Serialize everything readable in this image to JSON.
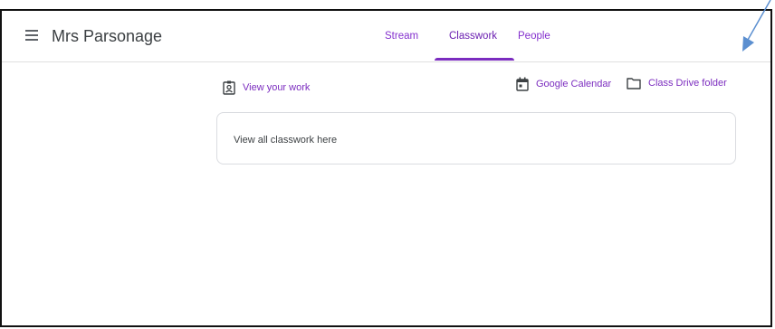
{
  "header": {
    "class_title": "Mrs Parsonage",
    "menu_icon": "hamburger-menu-icon",
    "tabs": [
      {
        "label": "Stream",
        "active": false
      },
      {
        "label": "Classwork",
        "active": true
      },
      {
        "label": "People",
        "active": false
      }
    ]
  },
  "toolbar": {
    "view_work_label": "View your work",
    "view_work_icon": "assignment-ind-icon",
    "calendar_label": "Google Calendar",
    "calendar_icon": "calendar-icon",
    "drive_label": "Class Drive folder",
    "drive_icon": "folder-icon"
  },
  "main": {
    "card_text": "View all classwork here"
  },
  "annotation": {
    "arrow_color": "#5b8fd0",
    "arrow_icon": "annotation-arrow"
  },
  "colors": {
    "accent": "#7b2cbf",
    "text": "#3c4043",
    "border": "#dadce0"
  }
}
